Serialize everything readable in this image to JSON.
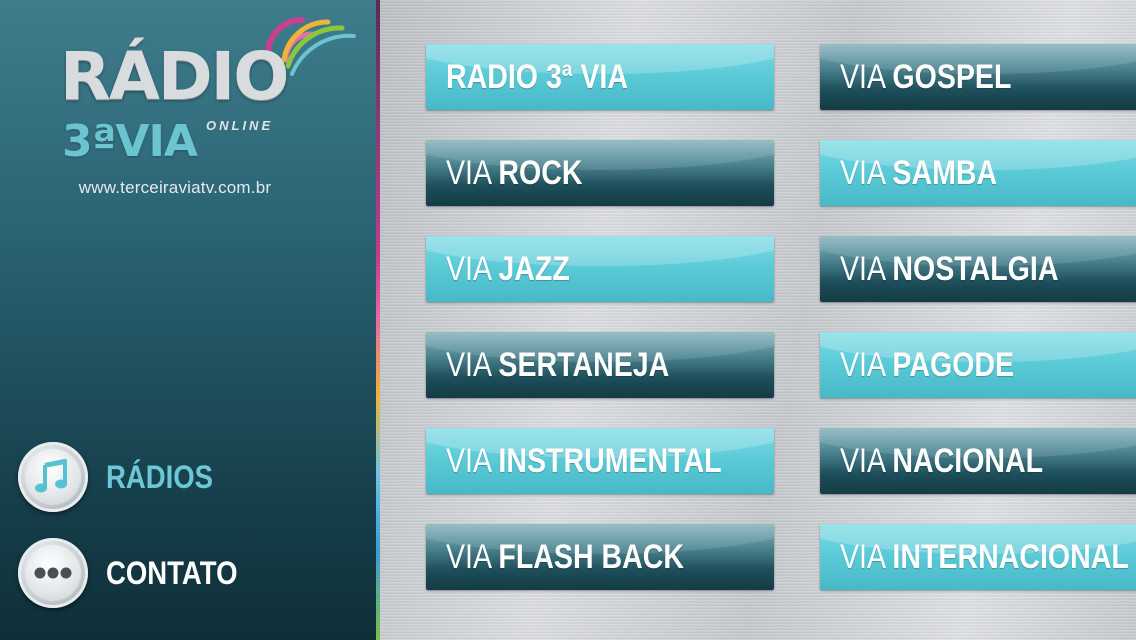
{
  "logo": {
    "radio": "RÁDIO",
    "three_via": "3ªVIA",
    "online": "ONLINE"
  },
  "url": "www.terceiraviatv.com.br",
  "nav": {
    "radios": {
      "label": "RÁDIOS",
      "icon": "music-note-icon"
    },
    "contato": {
      "label": "CONTATO",
      "icon": "ellipsis-icon"
    }
  },
  "colors": {
    "accent": "#6cc8d6",
    "button_light": "#5ccbd8",
    "button_dark": "#1d4e5a",
    "sidebar": "#2b6474"
  },
  "stations": [
    {
      "prefix": "",
      "name": "RADIO 3ª VIA",
      "style": "light"
    },
    {
      "prefix": "VIA ",
      "name": "GOSPEL",
      "style": "dark"
    },
    {
      "prefix": "VIA ",
      "name": "ROCK",
      "style": "dark"
    },
    {
      "prefix": "VIA ",
      "name": "SAMBA",
      "style": "light"
    },
    {
      "prefix": "VIA ",
      "name": "JAZZ",
      "style": "light"
    },
    {
      "prefix": "VIA ",
      "name": "NOSTALGIA",
      "style": "dark"
    },
    {
      "prefix": "VIA ",
      "name": "SERTANEJA",
      "style": "dark"
    },
    {
      "prefix": "VIA ",
      "name": "PAGODE",
      "style": "light"
    },
    {
      "prefix": "VIA ",
      "name": "INSTRUMENTAL",
      "style": "light"
    },
    {
      "prefix": "VIA ",
      "name": "NACIONAL",
      "style": "dark"
    },
    {
      "prefix": "VIA ",
      "name": "FLASH BACK",
      "style": "dark"
    },
    {
      "prefix": "VIA ",
      "name": "INTERNACIONAL",
      "style": "light"
    }
  ]
}
